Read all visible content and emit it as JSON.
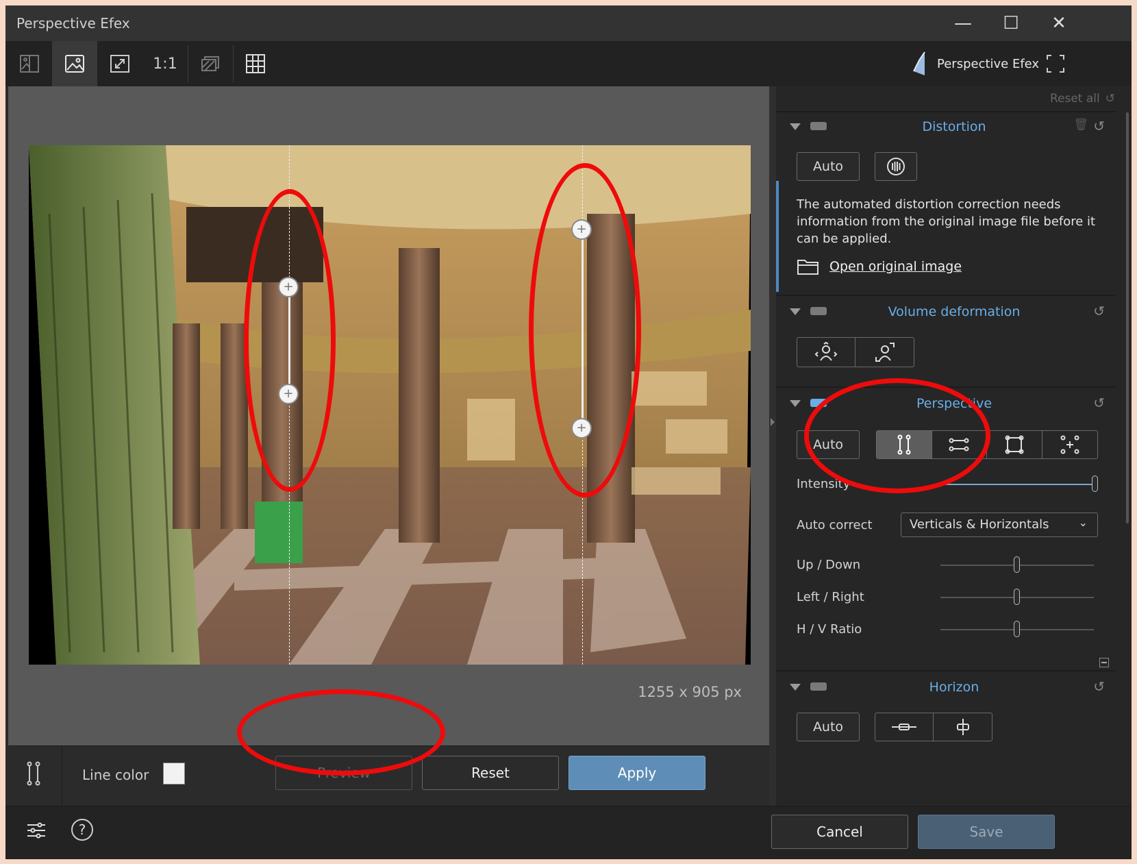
{
  "window": {
    "title": "Perspective Efex",
    "minimize": "—",
    "maximize": "☐",
    "close": "✕"
  },
  "toolbar": {
    "zoom_1to1": "1:1",
    "brand_name": "Perspective Efex"
  },
  "canvas": {
    "image_dimensions": "1255 x 905 px"
  },
  "panel": {
    "reset_all": "Reset all",
    "distortion": {
      "title": "Distortion",
      "auto_label": "Auto",
      "info_text": "The automated distortion correction needs information from the original image file before it can be applied.",
      "open_original_link": "Open original image"
    },
    "volume_deformation": {
      "title": "Volume deformation"
    },
    "perspective": {
      "title": "Perspective",
      "auto_label": "Auto",
      "intensity_label": "Intensity",
      "intensity_value": 1.0,
      "auto_correct_label": "Auto correct",
      "auto_correct_value": "Verticals & Horizontals",
      "up_down_label": "Up / Down",
      "up_down_value": 0.5,
      "left_right_label": "Left / Right",
      "left_right_value": 0.5,
      "hv_ratio_label": "H / V Ratio",
      "hv_ratio_value": 0.5
    },
    "horizon": {
      "title": "Horizon",
      "auto_label": "Auto"
    }
  },
  "bottom_bar": {
    "line_color_label": "Line color",
    "line_color_value": "#f2f2f2",
    "preview_label": "Preview",
    "reset_label": "Reset",
    "apply_label": "Apply"
  },
  "footer": {
    "cancel_label": "Cancel",
    "save_label": "Save",
    "help_glyph": "?"
  },
  "colors": {
    "accent": "#6aaee8",
    "apply_button": "#5e8db7",
    "annotation_red": "#ee0b0b"
  }
}
